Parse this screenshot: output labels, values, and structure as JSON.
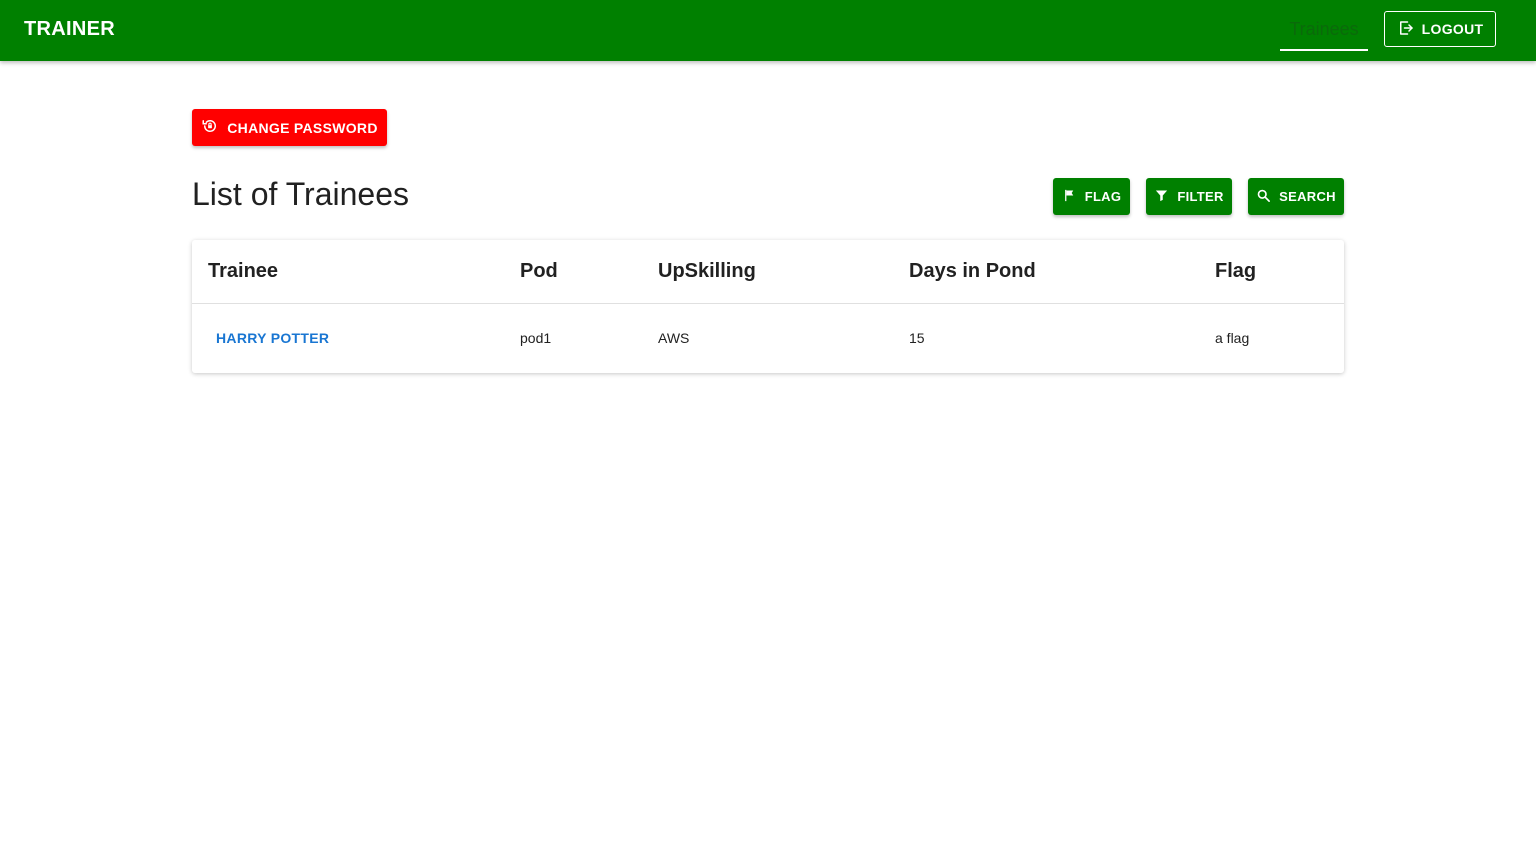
{
  "appbar": {
    "brand": "TRAINER",
    "nav_tab": "Trainees",
    "logout_label": "LOGOUT",
    "color": "#008000"
  },
  "change_password_label": "CHANGE PASSWORD",
  "page_title": "List of Trainees",
  "actions": {
    "flag_label": "FLAG",
    "filter_label": "FILTER",
    "search_label": "SEARCH"
  },
  "table": {
    "headers": [
      "Trainee",
      "Pod",
      "UpSkilling",
      "Days in Pond",
      "Flag"
    ],
    "rows": [
      {
        "trainee": "HARRY POTTER",
        "pod": "pod1",
        "upskilling": "AWS",
        "days": "15",
        "flag": "a flag"
      }
    ]
  },
  "colors": {
    "accent": "#008000",
    "danger": "#ff0000",
    "link": "#1976d2"
  },
  "icons": {
    "logout": "logout-icon",
    "change_password": "lock-reset-icon",
    "flag": "flag-icon",
    "filter": "filter-icon",
    "search": "search-icon"
  }
}
